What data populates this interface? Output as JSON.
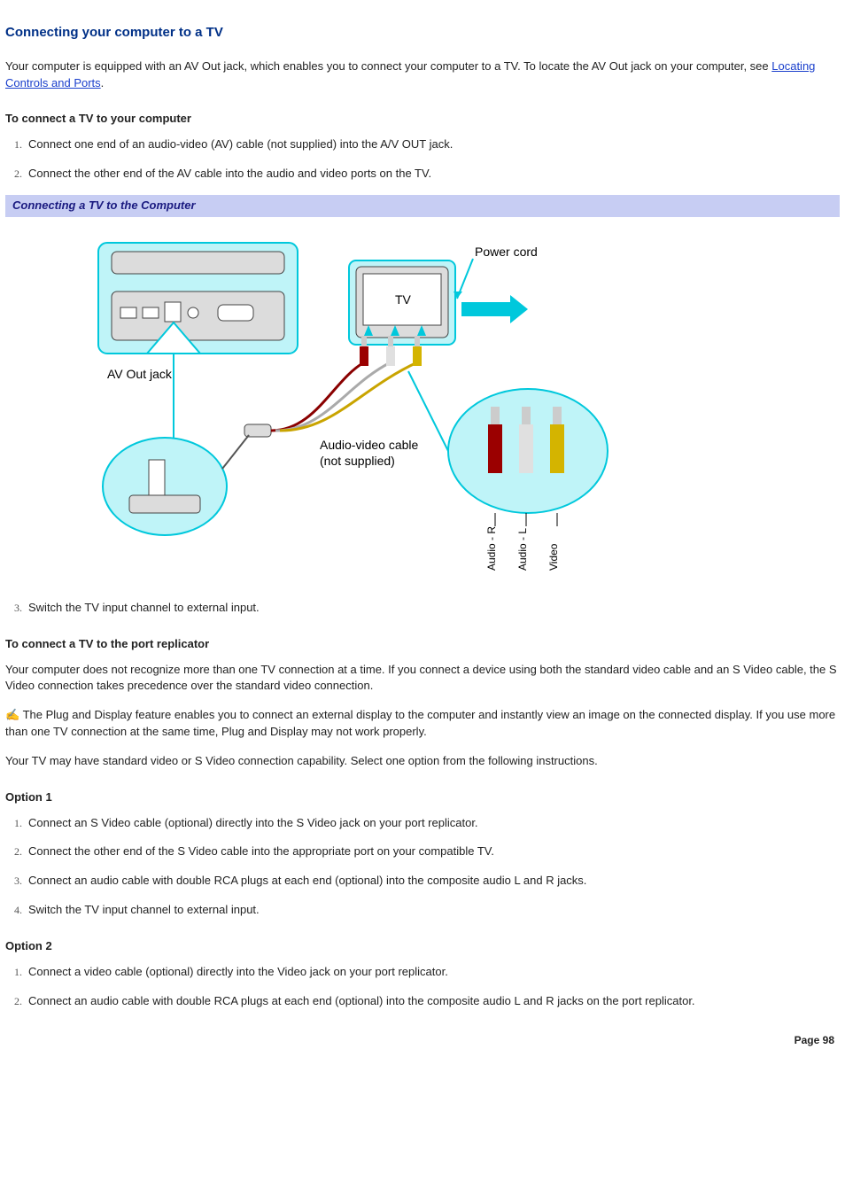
{
  "title": "Connecting your computer to a TV",
  "intro_pre": "Your computer is equipped with an AV Out jack, which enables you to connect your computer to a TV. To locate the AV Out jack on your computer, see ",
  "intro_link": "Locating Controls and Ports",
  "intro_post": ".",
  "sec1_heading": "To connect a TV to your computer",
  "sec1_steps": [
    "Connect one end of an audio-video (AV) cable (not supplied) into the A/V OUT jack.",
    "Connect the other end of the AV cable into the audio and video ports on the TV."
  ],
  "figure_bar": "Connecting a TV to the Computer",
  "figure_labels": {
    "power_cord": "Power cord",
    "tv": "TV",
    "av_out": "AV Out jack",
    "av_cable_l1": "Audio-video cable",
    "av_cable_l2": "(not supplied)",
    "audio_r": "Audio - R",
    "audio_l": "Audio - L",
    "video": "Video"
  },
  "sec1_steps_after": [
    "Switch the TV input channel to external input."
  ],
  "sec2_heading": "To connect a TV to the port replicator",
  "sec2_para1": "Your computer does not recognize more than one TV connection at a time. If you connect a device using both the standard video cable and an S Video cable, the S Video connection takes precedence over the standard video connection.",
  "sec2_note": "The Plug and Display feature enables you to connect an external display to the computer and instantly view an image on the connected display. If you use more than one TV connection at the same time, Plug and Display may not work properly.",
  "sec2_para2": "Your TV may have standard video or S Video connection capability. Select one option from the following instructions.",
  "opt1_heading": "Option 1",
  "opt1_steps": [
    "Connect an S Video cable (optional) directly into the S Video jack on your port replicator.",
    "Connect the other end of the S Video cable into the appropriate port on your compatible TV.",
    "Connect an audio cable with double RCA plugs at each end (optional) into the composite audio L and R jacks.",
    "Switch the TV input channel to external input."
  ],
  "opt2_heading": "Option 2",
  "opt2_steps": [
    "Connect a video cable (optional) directly into the Video jack on your port replicator.",
    "Connect an audio cable with double RCA plugs at each end (optional) into the composite audio L and R jacks on the port replicator."
  ],
  "page_number": "Page 98"
}
